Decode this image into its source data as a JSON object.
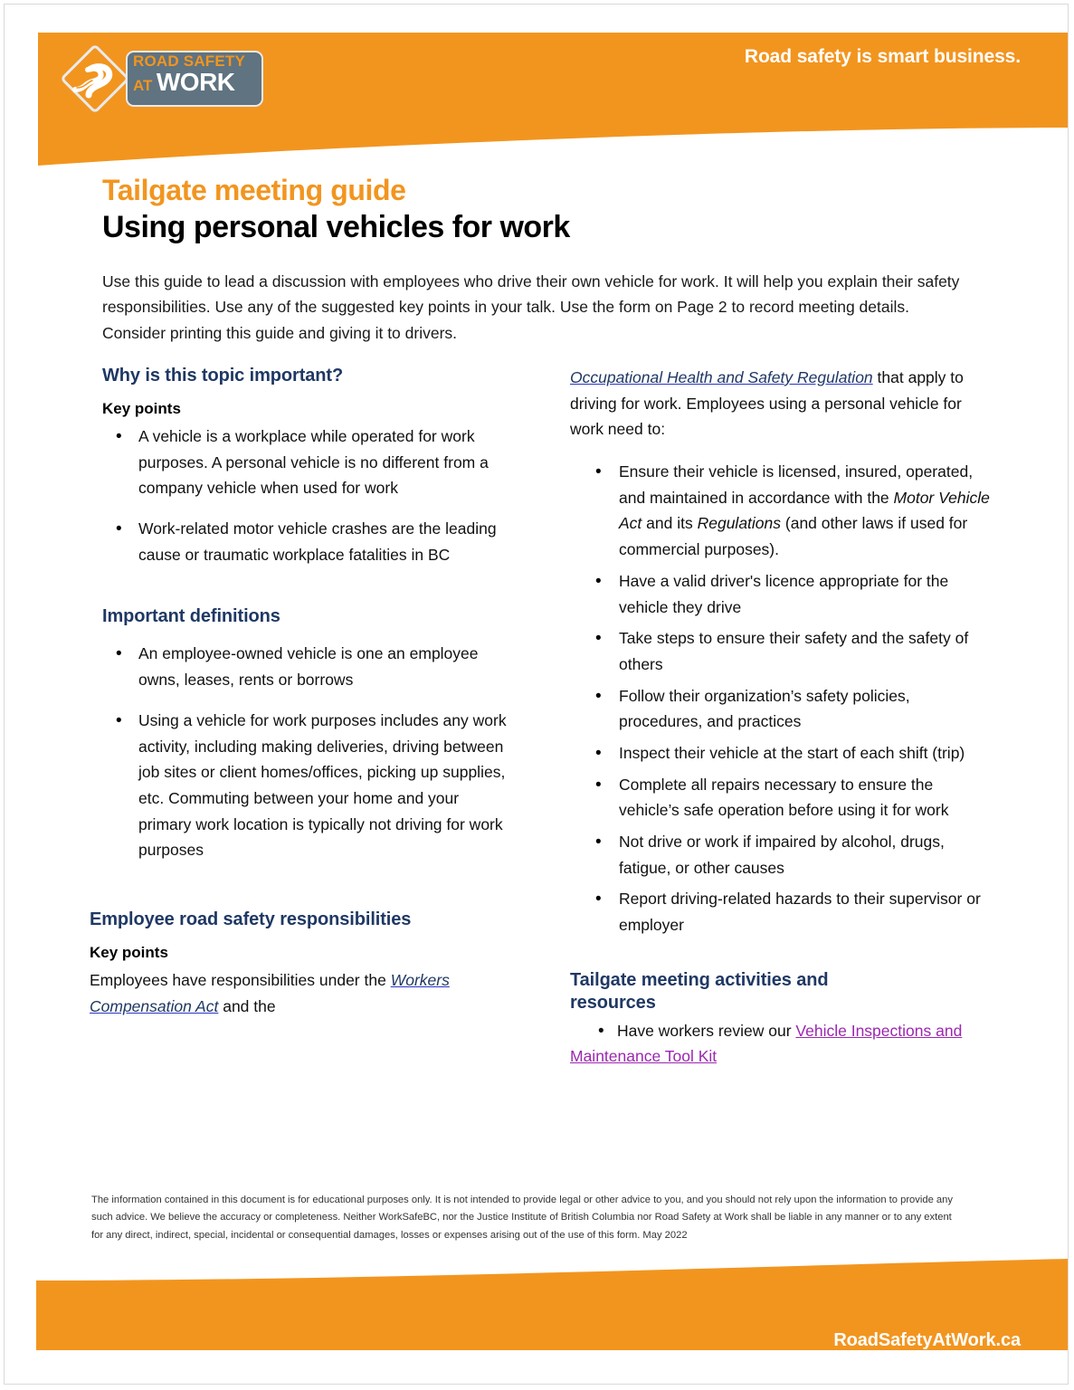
{
  "colors": {
    "brand_orange": "#f2951f",
    "heading_navy": "#1f3864",
    "logo_slate": "#5f7380",
    "link_blue": "#1f3864",
    "link_purple": "#9c27b0"
  },
  "header": {
    "logo": {
      "line1": "ROAD SAFETY",
      "at": "AT",
      "work": "WORK",
      "diamond_icon": "winding-road-diamond-icon"
    },
    "tagline": "Road safety is smart business."
  },
  "title": {
    "kicker": "Tailgate meeting guide",
    "main": "Using personal vehicles for work"
  },
  "intro": "Use this guide to lead a discussion with employees who drive their own vehicle for work. It will help you explain their safety responsibilities. Use any of the suggested key points in your talk. Use the form on Page 2 to record meeting details. Consider printing this guide and giving it to drivers.",
  "left_column": {
    "section_1": {
      "heading": "Why is this topic important?",
      "subheading": "Key points",
      "bullets": [
        "A vehicle is a workplace while operated for work purposes. A personal vehicle is no different from a company vehicle when used for work",
        "Work-related motor vehicle crashes are the leading cause or traumatic workplace fatalities in BC"
      ]
    },
    "section_2": {
      "heading": "Important definitions",
      "bullets": [
        "An employee-owned vehicle is one an employee owns, leases, rents or borrows",
        "Using a vehicle for work purposes includes any work activity, including making deliveries, driving between job sites or client homes/offices, picking up supplies, etc. Commuting between your home and your primary work location is typically not driving for work purposes"
      ]
    },
    "section_3": {
      "heading": "Employee road safety responsibilities",
      "subheading": "Key points",
      "paragraph_before_link": "Employees have responsibilities under the ",
      "link_text": "Workers Compensation Act",
      "paragraph_after_link": " and the"
    }
  },
  "right_column": {
    "continued_paragraph": {
      "link_text": "Occupational Health and Safety Regulation",
      "after_link": " that apply to driving for work. Employees using a personal vehicle for work need to:"
    },
    "bullets": [
      {
        "part1": "Ensure their vehicle is licensed, insured, operated, and maintained in accordance with the ",
        "italic1": "Motor Vehicle Act",
        "part2": " and its ",
        "italic2": "Regulations",
        "part3": " (and other laws if used for commercial purposes)."
      },
      {
        "text": "Have a valid driver's licence appropriate for the vehicle they drive"
      },
      {
        "text": "Take steps to ensure their safety and the safety of others"
      },
      {
        "text": "Follow their organization’s safety policies, procedures, and practices"
      },
      {
        "text": "Inspect their vehicle at the start of each shift (trip)"
      },
      {
        "text": "Complete all repairs necessary to ensure the vehicle’s safe operation before using it for work"
      },
      {
        "text": "Not drive or work if impaired by alcohol, drugs, fatigue, or other causes"
      },
      {
        "text": "Report driving-related hazards to their supervisor or employer"
      }
    ],
    "resources": {
      "heading": "Tailgate meeting activities and resources",
      "bullet_prefix": "Have workers review our ",
      "link_text": "Vehicle Inspections and Maintenance Tool Kit"
    }
  },
  "disclaimer": "The information contained in this document is for educational purposes only. It is not intended to provide legal or other advice to you, and you should not rely upon the information to provide any such advice. We believe the accuracy or completeness. Neither WorkSafeBC, nor the Justice Institute of British Columbia nor Road Safety at Work shall be liable in any manner or to any extent for any direct, indirect, special, incidental or consequential damages, losses or expenses arising out of the use of this form. May 2022",
  "footer": {
    "url": "RoadSafetyAtWork.ca"
  }
}
